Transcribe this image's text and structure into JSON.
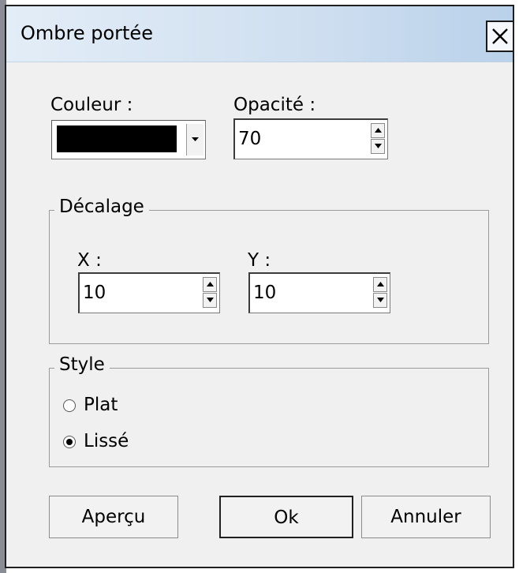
{
  "window": {
    "title": "Ombre portée"
  },
  "couleur": {
    "label": "Couleur :",
    "value_color": "#000000"
  },
  "opacite": {
    "label": "Opacité :",
    "value": "70"
  },
  "decalage": {
    "legend": "Décalage",
    "x": {
      "label": "X :",
      "value": "10"
    },
    "y": {
      "label": "Y :",
      "value": "10"
    }
  },
  "style": {
    "legend": "Style",
    "options": [
      {
        "label": "Plat",
        "selected": false
      },
      {
        "label": "Lissé",
        "selected": true
      }
    ]
  },
  "buttons": {
    "apercu": "Aperçu",
    "ok": "Ok",
    "annuler": "Annuler"
  },
  "icons": {
    "close": "close-icon",
    "dropdown": "chevron-down-icon",
    "spin_up": "arrow-up-icon",
    "spin_down": "arrow-down-icon"
  }
}
